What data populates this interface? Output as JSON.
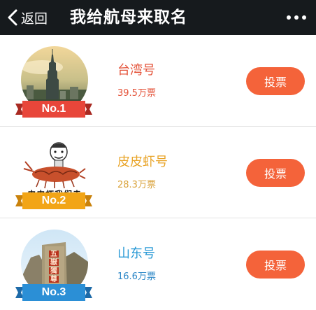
{
  "nav": {
    "back_label": "返回",
    "title": "我给航母来取名"
  },
  "entries": [
    {
      "rank": "No.1",
      "name": "台湾号",
      "votes": "39.5万票",
      "vote_label": "投票",
      "name_color": "#e4533a",
      "votes_color": "#e4533a",
      "ribbon_color": "#e8463a",
      "image": "taipei-101-skyline-image"
    },
    {
      "rank": "No.2",
      "name": "皮皮虾号",
      "votes": "28.3万票",
      "vote_label": "投票",
      "name_color": "#e9a52a",
      "votes_color": "#d9a23a",
      "ribbon_color": "#f2a516",
      "image": "mantis-shrimp-meme-image",
      "image_caption": "皮皮虾我们走"
    },
    {
      "rank": "No.3",
      "name": "山东号",
      "votes": "16.6万票",
      "vote_label": "投票",
      "name_color": "#2a9ad6",
      "votes_color": "#2a86c6",
      "ribbon_color": "#2b8fd6",
      "image": "mount-tai-inscription-image",
      "image_caption": "五嶽獨尊"
    }
  ]
}
